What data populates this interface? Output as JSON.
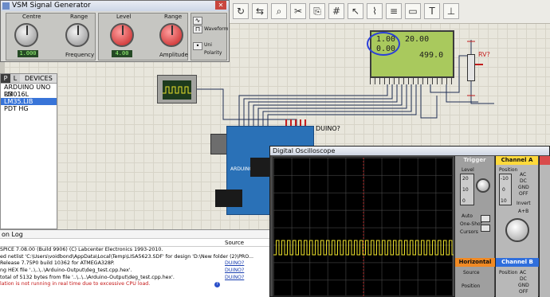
{
  "siggen": {
    "title": "VSM Signal Generator",
    "centre_label": "Centre",
    "centre_value": "1.000",
    "frequency_label": "Frequency",
    "range_label": "Range",
    "level_label": "Level",
    "level_value": "4.00",
    "amplitude_label": "Amplitude",
    "waveform_label": "Waveform",
    "polarity_label": "Polarity",
    "uni_label": "Uni",
    "bi_label": "Bi"
  },
  "devices": {
    "p_label": "P",
    "l_label": "L",
    "title": "DEVICES",
    "items": [
      "ARDUINO UNO R3",
      "LM016L",
      "LM35.LIB",
      "PDT HG"
    ]
  },
  "schematic": {
    "lcd_line1_left": "1.00",
    "lcd_line1_right": "20.00",
    "lcd_line2_left": "0.00",
    "lcd_line2_right": "499.0",
    "pot_label": "RV?",
    "arduino_label": "DUINO?",
    "arduino_text": "ARDUINO UNO R3"
  },
  "log": {
    "title": "on Log",
    "source_header": "Source",
    "rows": [
      {
        "text": "SPICE 7.08.00 (Build 9906) (C) Labcenter Electronics 1993-2010.",
        "source": ""
      },
      {
        "text": "ed netlist 'C:\\Users\\voidbond\\AppData\\Local\\Temp\\LISA5623.SDF' for design 'D:\\New folder (2)\\PRO...",
        "source": ""
      },
      {
        "text": "Release 7.75P0 build 10362 for ATMEGA328P.",
        "source": "DUINO?"
      },
      {
        "text": "ng HEX file '..\\..\\..\\Arduino-Output\\deg_test.cpp.hex'.",
        "source": "DUINO?"
      },
      {
        "text": "total of 5132 bytes from file '..\\..\\..\\Arduino-Output\\deg_test.cpp.hex'.",
        "source": "DUINO?"
      },
      {
        "text": "lation is not running in real time due to excessive CPU load.",
        "source": ""
      }
    ]
  },
  "oscilloscope": {
    "title": "Digital Oscilloscope",
    "trigger": "Trigger",
    "channel_a": "Channel A",
    "channel_b": "Channel B",
    "horizontal": "Horizontal",
    "level": "Level",
    "auto": "Auto",
    "one_shot": "One-Shot",
    "cursors": "Cursors",
    "source": "Source",
    "position": "Position",
    "ac": "AC",
    "dc": "DC",
    "gnd": "GND",
    "off": "OFF",
    "invert": "Invert",
    "a_plus_b": "A+B"
  },
  "colors": {
    "trigger": "#f7f7f7",
    "channel_a": "#ffd93a",
    "channel_b": "#2f6edc",
    "horizontal": "#f08a24",
    "trace": "#ece12a"
  }
}
